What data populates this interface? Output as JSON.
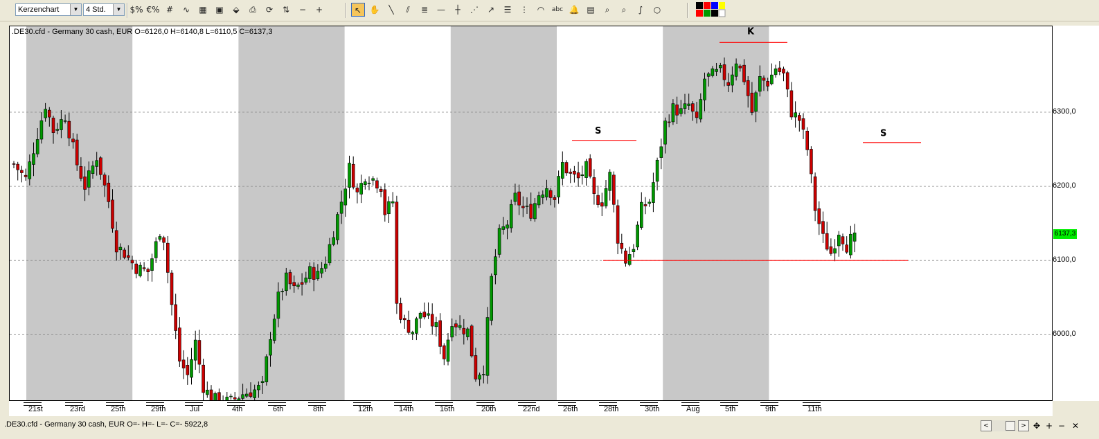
{
  "toolbar": {
    "chart_type": "Kerzenchart",
    "timeframe": "4 Std.",
    "tools": [
      {
        "name": "dollar-scale-icon",
        "glyph": "$%"
      },
      {
        "name": "euro-scale-icon",
        "glyph": "€%"
      },
      {
        "name": "grid-icon",
        "glyph": "#"
      },
      {
        "name": "indicator-icon",
        "glyph": "∿"
      },
      {
        "name": "template-icon",
        "glyph": "▦"
      },
      {
        "name": "image-icon",
        "glyph": "▣"
      },
      {
        "name": "eraser-icon",
        "glyph": "⬙"
      },
      {
        "name": "print-icon",
        "glyph": "⎙"
      },
      {
        "name": "refresh-icon",
        "glyph": "⟳"
      },
      {
        "name": "trade-icon",
        "glyph": "⇅"
      },
      {
        "name": "zoom-out-icon",
        "glyph": "−"
      },
      {
        "name": "zoom-in-icon",
        "glyph": "+"
      },
      {
        "name": "cursor-icon",
        "glyph": "↖"
      },
      {
        "name": "hand-icon",
        "glyph": "✋"
      },
      {
        "name": "line-icon",
        "glyph": "╲"
      },
      {
        "name": "parallel-line-icon",
        "glyph": "⫽"
      },
      {
        "name": "fibonacci-icon",
        "glyph": "≣"
      },
      {
        "name": "horizontal-line-icon",
        "glyph": "—"
      },
      {
        "name": "vertical-line-icon",
        "glyph": "┼"
      },
      {
        "name": "fan-icon",
        "glyph": "⋰"
      },
      {
        "name": "arrow-tool-icon",
        "glyph": "↗"
      },
      {
        "name": "fibonacci-levels-icon",
        "glyph": "☰"
      },
      {
        "name": "time-zones-icon",
        "glyph": "⋮"
      },
      {
        "name": "arc-icon",
        "glyph": "◠"
      },
      {
        "name": "text-icon",
        "glyph": "abc"
      },
      {
        "name": "alarm-bell-icon",
        "glyph": "🔔"
      },
      {
        "name": "calculator-icon",
        "glyph": "▤"
      },
      {
        "name": "search-icon",
        "glyph": "⌕"
      },
      {
        "name": "magnifier-icon",
        "glyph": "⌕"
      },
      {
        "name": "curve-icon",
        "glyph": "∫"
      },
      {
        "name": "ellipse-icon",
        "glyph": "○"
      },
      {
        "name": "color-palette-icon",
        "glyph": ""
      }
    ]
  },
  "chart": {
    "header": ".DE30.cfd - Germany 30 cash, EUR O=6126,0 H=6140,8 L=6110,5 C=6137,3",
    "current_price": "6137,3",
    "y_ticks": [
      "6300,0",
      "6200,0",
      "6100,0",
      "6000,0"
    ],
    "x_labels": [
      "21st",
      "23rd",
      "25th",
      "29th",
      "Jul",
      "4th",
      "6th",
      "8th",
      "12th",
      "14th",
      "16th",
      "20th",
      "22nd",
      "26th",
      "28th",
      "30th",
      "Aug",
      "5th",
      "9th",
      "11th"
    ],
    "annotations": [
      "S",
      "K",
      "S"
    ],
    "colors": {
      "up": "#009900",
      "down": "#cc0000",
      "shade": "#c8c8c8",
      "line": "#ff0000",
      "price_tag": "#00ee00"
    }
  },
  "chart_data": {
    "type": "candlestick",
    "title": ".DE30.cfd - Germany 30 cash, EUR",
    "last_bar": {
      "open": 6126.0,
      "high": 6140.8,
      "low": 6110.5,
      "close": 6137.3
    },
    "ylim": [
      5915,
      6420
    ],
    "y_ticks": [
      6000,
      6100,
      6200,
      6300
    ],
    "grid": "horizontal dashed",
    "close_path": [
      [
        0,
        6230
      ],
      [
        3,
        6210
      ],
      [
        5,
        6250
      ],
      [
        8,
        6310
      ],
      [
        10,
        6275
      ],
      [
        13,
        6295
      ],
      [
        16,
        6230
      ],
      [
        18,
        6200
      ],
      [
        21,
        6240
      ],
      [
        24,
        6180
      ],
      [
        26,
        6120
      ],
      [
        28,
        6110
      ],
      [
        31,
        6090
      ],
      [
        34,
        6085
      ],
      [
        37,
        6140
      ],
      [
        38,
        6130
      ],
      [
        40,
        6040
      ],
      [
        42,
        5965
      ],
      [
        44,
        5945
      ],
      [
        46,
        5990
      ],
      [
        48,
        5930
      ],
      [
        50,
        5915
      ],
      [
        52,
        5910
      ],
      [
        55,
        5910
      ],
      [
        58,
        5920
      ],
      [
        61,
        5925
      ],
      [
        63,
        5930
      ],
      [
        65,
        6000
      ],
      [
        67,
        6050
      ],
      [
        69,
        6075
      ],
      [
        71,
        6060
      ],
      [
        73,
        6070
      ],
      [
        75,
        6085
      ],
      [
        77,
        6080
      ],
      [
        79,
        6100
      ],
      [
        81,
        6140
      ],
      [
        83,
        6180
      ],
      [
        85,
        6225
      ],
      [
        87,
        6190
      ],
      [
        89,
        6215
      ],
      [
        91,
        6210
      ],
      [
        93,
        6200
      ],
      [
        94,
        6165
      ],
      [
        96,
        6180
      ],
      [
        97,
        6040
      ],
      [
        99,
        6015
      ],
      [
        101,
        6005
      ],
      [
        103,
        6030
      ],
      [
        105,
        6020
      ],
      [
        107,
        6010
      ],
      [
        109,
        5970
      ],
      [
        111,
        6020
      ],
      [
        113,
        6010
      ],
      [
        115,
        6005
      ],
      [
        117,
        5945
      ],
      [
        119,
        5955
      ],
      [
        121,
        6075
      ],
      [
        123,
        6135
      ],
      [
        125,
        6150
      ],
      [
        127,
        6185
      ],
      [
        129,
        6170
      ],
      [
        131,
        6165
      ],
      [
        133,
        6190
      ],
      [
        135,
        6200
      ],
      [
        137,
        6185
      ],
      [
        139,
        6230
      ],
      [
        141,
        6215
      ],
      [
        143,
        6210
      ],
      [
        145,
        6225
      ],
      [
        147,
        6185
      ],
      [
        149,
        6180
      ],
      [
        151,
        6215
      ],
      [
        153,
        6130
      ],
      [
        155,
        6100
      ],
      [
        157,
        6120
      ],
      [
        159,
        6170
      ],
      [
        161,
        6180
      ],
      [
        163,
        6230
      ],
      [
        165,
        6285
      ],
      [
        167,
        6305
      ],
      [
        169,
        6300
      ],
      [
        171,
        6310
      ],
      [
        173,
        6285
      ],
      [
        175,
        6345
      ],
      [
        177,
        6350
      ],
      [
        179,
        6355
      ],
      [
        181,
        6340
      ],
      [
        183,
        6370
      ],
      [
        185,
        6345
      ],
      [
        187,
        6300
      ],
      [
        189,
        6345
      ],
      [
        191,
        6340
      ],
      [
        193,
        6360
      ],
      [
        195,
        6350
      ],
      [
        197,
        6300
      ],
      [
        199,
        6290
      ],
      [
        201,
        6250
      ],
      [
        203,
        6170
      ],
      [
        205,
        6130
      ],
      [
        207,
        6110
      ],
      [
        209,
        6140
      ],
      [
        211,
        6120
      ],
      [
        213,
        6137
      ]
    ],
    "sessions": [
      {
        "label": "21st",
        "shaded": true
      },
      {
        "label": "25th",
        "shaded": false
      },
      {
        "label": "Jul",
        "shaded": true
      },
      {
        "label": "8th",
        "shaded": false
      },
      {
        "label": "16th",
        "shaded": true
      },
      {
        "label": "26th",
        "shaded": false
      },
      {
        "label": "Aug",
        "shaded": true
      },
      {
        "label": "9th",
        "shaded": false
      }
    ],
    "horizontal_lines": [
      {
        "label": "S",
        "level": 6265
      },
      {
        "label": "K",
        "level": 6405
      },
      {
        "label": "S",
        "level": 6264
      },
      {
        "label": "",
        "level": 6100
      }
    ]
  },
  "status": {
    "text": ".DE30.cfd - Germany 30 cash, EUR O=- H=- L=- C=-    5922,8"
  },
  "nav": {
    "left": "<",
    "right": ">",
    "move": "✥",
    "plus": "+",
    "minus": "−",
    "close": "✕"
  }
}
